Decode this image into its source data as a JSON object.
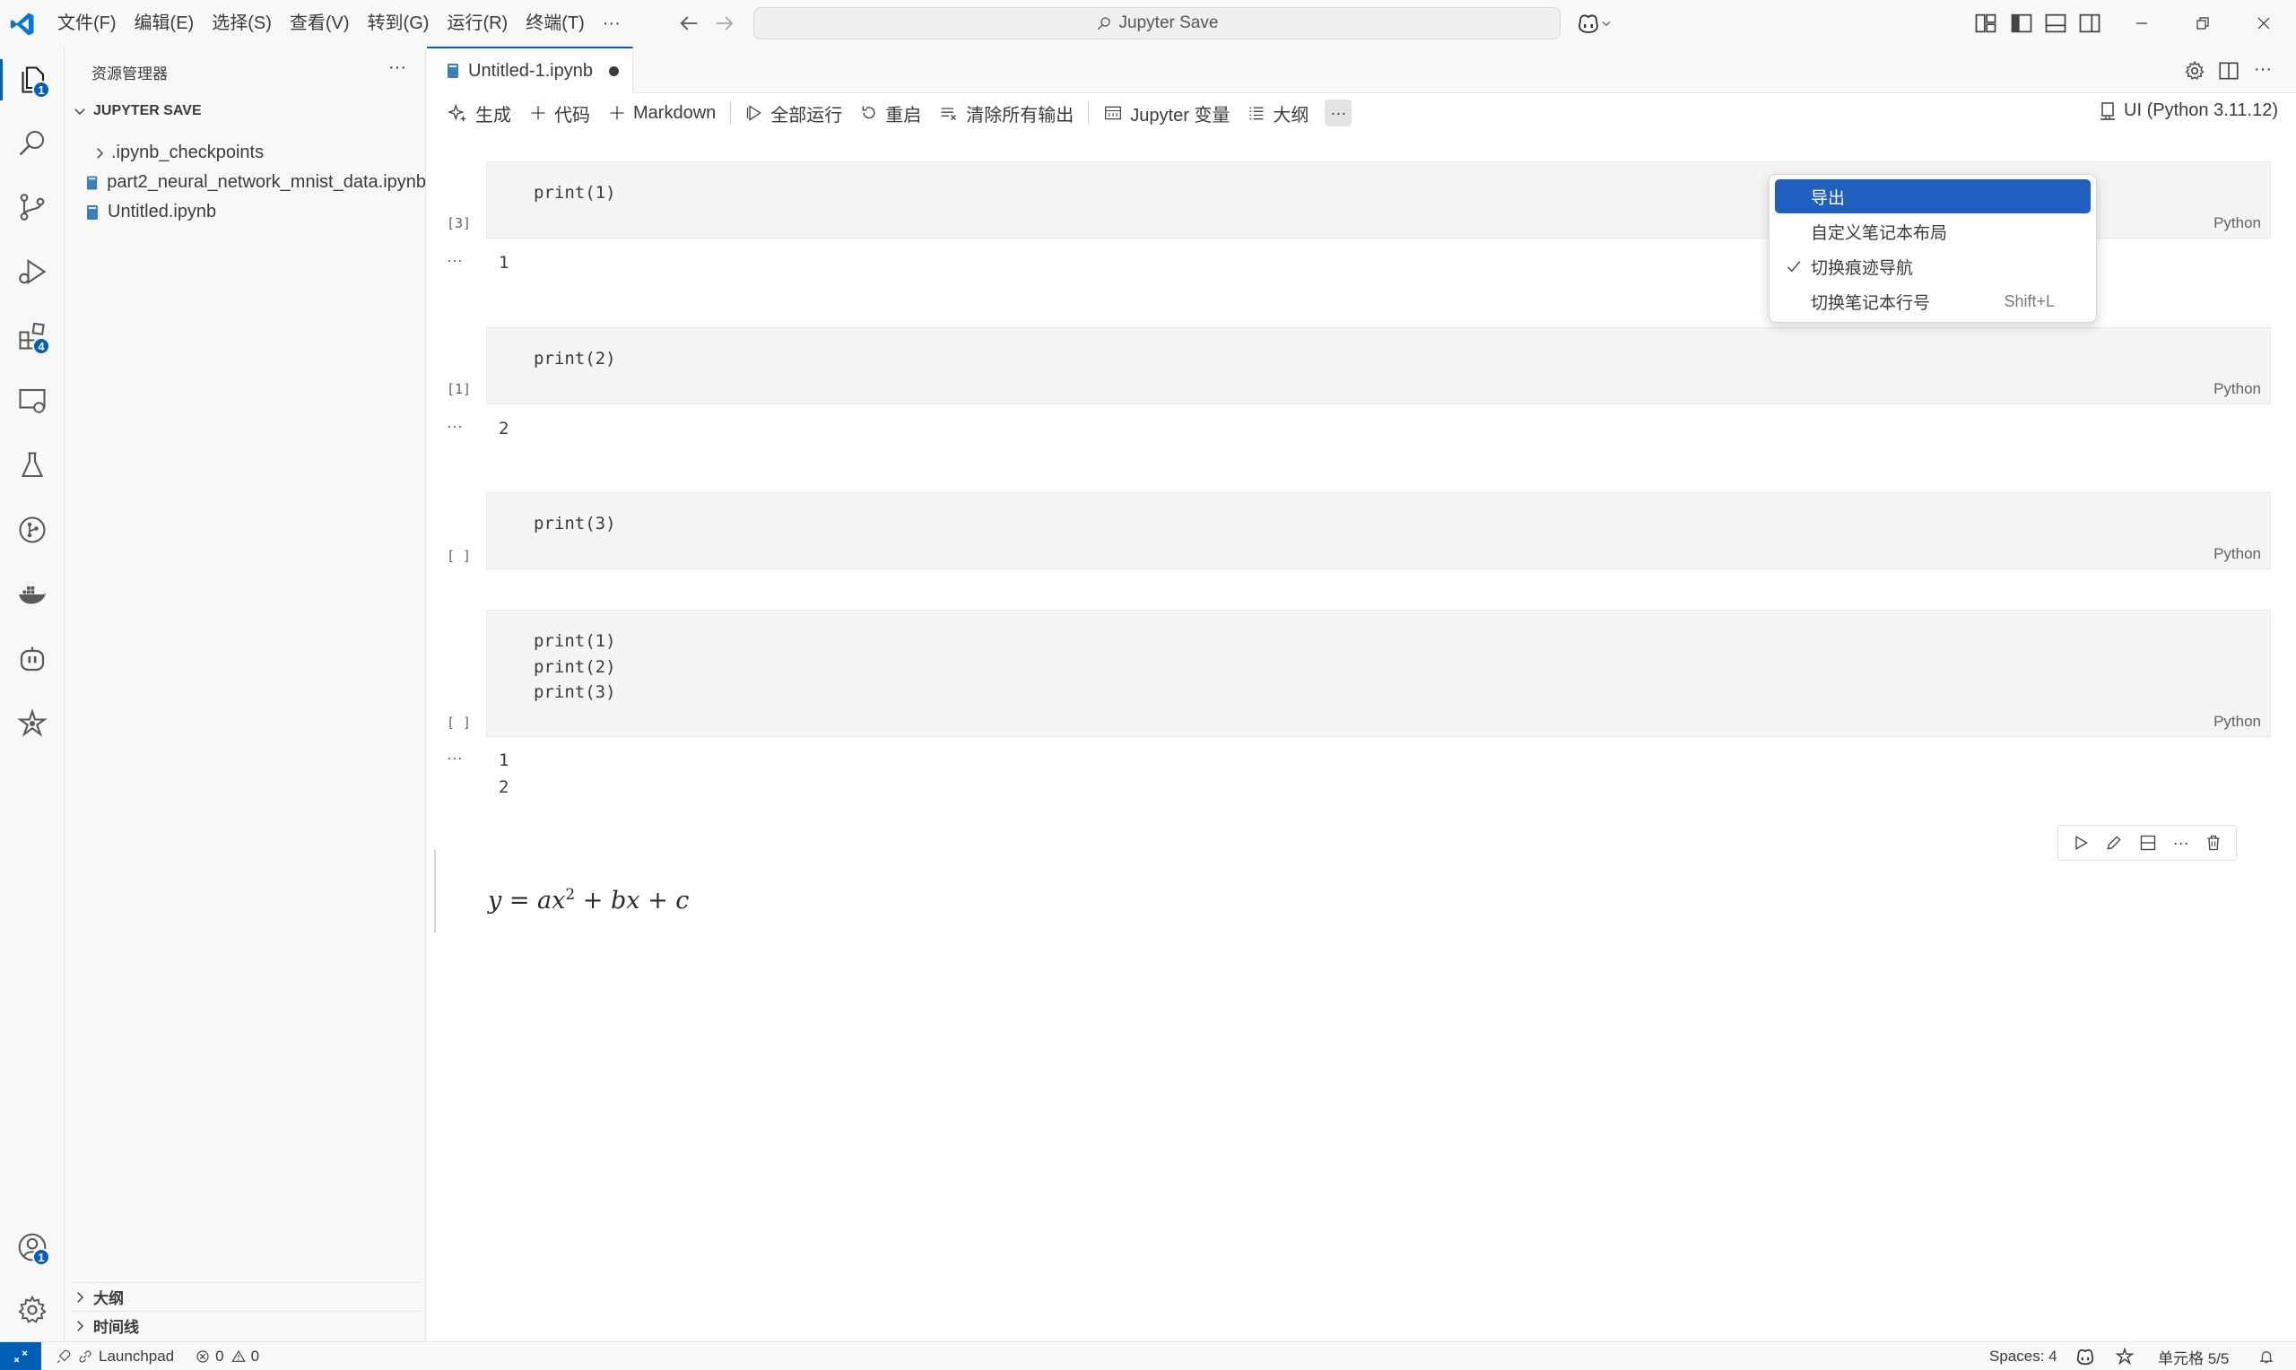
{
  "titlebar": {
    "menus": [
      "文件(F)",
      "编辑(E)",
      "选择(S)",
      "查看(V)",
      "转到(G)",
      "运行(R)",
      "终端(T)",
      "···"
    ],
    "command_center": "Jupyter Save"
  },
  "activity_badges": {
    "explorer": "1",
    "extensions": "4",
    "accounts": "1"
  },
  "sidebar": {
    "title": "资源管理器",
    "more": "···",
    "folder": "JUPYTER SAVE",
    "items": [
      {
        "label": ".ipynb_checkpoints",
        "kind": "folder"
      },
      {
        "label": "part2_neural_network_mnist_data.ipynb",
        "kind": "notebook"
      },
      {
        "label": "Untitled.ipynb",
        "kind": "notebook"
      }
    ],
    "panes": [
      "大纲",
      "时间线"
    ]
  },
  "tab": {
    "label": "Untitled-1.ipynb",
    "dirty": true
  },
  "toolbar": {
    "generate": "生成",
    "code": "代码",
    "markdown": "Markdown",
    "run_all": "全部运行",
    "restart": "重启",
    "clear_outputs": "清除所有输出",
    "variables": "Jupyter 变量",
    "outline": "大纲",
    "more": "···",
    "kernel": "UI (Python 3.11.12)"
  },
  "cells": [
    {
      "count": "[3]",
      "code": "print(1)",
      "lang": "Python",
      "output": "1"
    },
    {
      "count": "[1]",
      "code": "print(2)",
      "lang": "Python",
      "output": "2"
    },
    {
      "count": "[ ]",
      "code": "print(3)",
      "lang": "Python",
      "output": ""
    },
    {
      "count": "[ ]",
      "code": "print(1)\nprint(2)\nprint(3)",
      "lang": "Python",
      "output": "1\n2"
    }
  ],
  "output_dots": "···",
  "markdown_cell": {
    "base": "y = ax",
    "exp": "2",
    "rest": " + bx + c"
  },
  "context_menu": {
    "items": [
      {
        "label": "导出",
        "checked": false,
        "key": ""
      },
      {
        "label": "自定义笔记本布局",
        "checked": false,
        "key": ""
      },
      {
        "label": "切换痕迹导航",
        "checked": true,
        "key": ""
      },
      {
        "label": "切换笔记本行号",
        "checked": false,
        "key": "Shift+L"
      }
    ]
  },
  "statusbar": {
    "launchpad": "Launchpad",
    "errors": "0",
    "warnings": "0",
    "spaces": "Spaces: 4",
    "cell_position": "单元格 5/5"
  },
  "colors": {
    "accent": "#005fb8",
    "menu_highlight": "#1f5fbf"
  }
}
